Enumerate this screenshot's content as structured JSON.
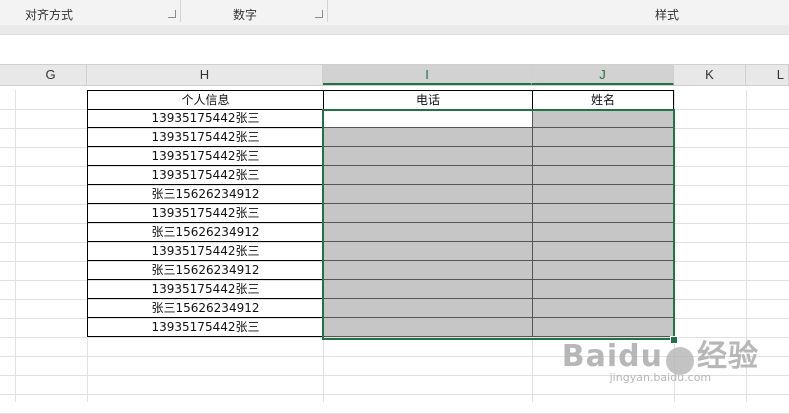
{
  "ribbon": {
    "groups": [
      {
        "label": "对齐方式"
      },
      {
        "label": "数字"
      },
      {
        "label": "样式"
      }
    ]
  },
  "columns": [
    "G",
    "H",
    "I",
    "J",
    "K",
    "L"
  ],
  "selected_columns": [
    "I",
    "J"
  ],
  "table": {
    "headers": {
      "h": "个人信息",
      "i": "电话",
      "j": "姓名"
    },
    "rows": [
      "13935175442张三",
      "13935175442张三",
      "13935175442张三",
      "13935175442张三",
      "张三15626234912",
      "13935175442张三",
      "张三15626234912",
      "13935175442张三",
      "张三15626234912",
      "13935175442张三",
      "张三15626234912",
      "13935175442张三"
    ]
  },
  "watermark": {
    "logo": "Baidu",
    "suffix": "经验",
    "url": "jingyan.baidu.com"
  },
  "colors": {
    "accent": "#217346",
    "selection_fill": "#c6c6c6",
    "header_bg": "#e8e8e8"
  }
}
